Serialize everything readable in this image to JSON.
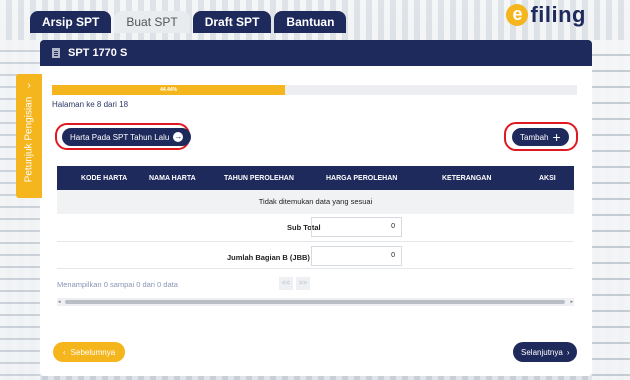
{
  "tabs": [
    {
      "label": "Arsip SPT",
      "active": false
    },
    {
      "label": "Buat SPT",
      "active": true
    },
    {
      "label": "Draft SPT",
      "active": false
    },
    {
      "label": "Bantuan",
      "active": false
    }
  ],
  "logo": {
    "mark": "e",
    "text": "filing"
  },
  "side_panel": {
    "label": "Petunjuk Pengisian",
    "icon": "chevron-right-icon"
  },
  "panel": {
    "title": "SPT 1770 S",
    "icon": "document-icon"
  },
  "progress": {
    "percent": 44.44,
    "label": "44.44%",
    "page_info": "Halaman ke 8 dari 18"
  },
  "buttons": {
    "harta_prev": "Harta Pada SPT Tahun Lalu",
    "tambah": "Tambah",
    "prev": "Sebelumnya",
    "next": "Selanjutnya"
  },
  "table": {
    "columns": [
      "KODE HARTA",
      "NAMA HARTA",
      "TAHUN PEROLEHAN",
      "HARGA PEROLEHAN",
      "KETERANGAN",
      "AKSI"
    ],
    "empty_message": "Tidak ditemukan data yang sesuai",
    "subtotal_label": "Sub Total",
    "subtotal_value": "0",
    "jbb_label": "Jumlah Bagian B (JBB)",
    "jbb_value": "0"
  },
  "pagination": {
    "info": "Menampilkan 0 sampai 0 dari 0 data",
    "first": "<<",
    "last": ">>"
  },
  "colors": {
    "navy": "#1f2a5c",
    "accent": "#f5b51c",
    "highlight": "#e0181f"
  }
}
